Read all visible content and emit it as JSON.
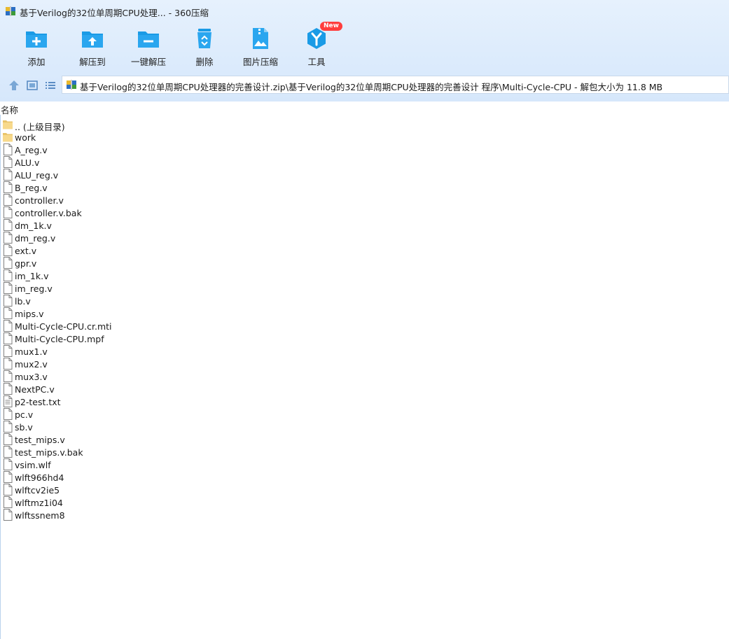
{
  "window": {
    "title": "基于Verilog的32位单周期CPU处理... - 360压缩"
  },
  "colors": {
    "accent": "#1a9be6",
    "band": "#dcebfc",
    "badge": "#ff3d3d"
  },
  "toolbar": {
    "items": [
      {
        "label": "添加",
        "icon": "add-folder-icon"
      },
      {
        "label": "解压到",
        "icon": "extract-to-icon"
      },
      {
        "label": "一键解压",
        "icon": "one-click-extract-icon"
      },
      {
        "label": "删除",
        "icon": "recycle-bin-icon"
      },
      {
        "label": "图片压缩",
        "icon": "image-compress-icon"
      },
      {
        "label": "工具",
        "icon": "tools-icon",
        "badge": "New"
      }
    ]
  },
  "nav": {
    "address": "基于Verilog的32位单周期CPU处理器的完善设计.zip\\基于Verilog的32位单周期CPU处理器的完善设计 程序\\Multi-Cycle-CPU - 解包大小为 11.8 MB"
  },
  "list": {
    "column_name": "名称",
    "items": [
      {
        "name": ".. (上级目录)",
        "type": "folder"
      },
      {
        "name": "work",
        "type": "folder"
      },
      {
        "name": "A_reg.v",
        "type": "file"
      },
      {
        "name": "ALU.v",
        "type": "file"
      },
      {
        "name": "ALU_reg.v",
        "type": "file"
      },
      {
        "name": "B_reg.v",
        "type": "file"
      },
      {
        "name": "controller.v",
        "type": "file"
      },
      {
        "name": "controller.v.bak",
        "type": "file"
      },
      {
        "name": "dm_1k.v",
        "type": "file"
      },
      {
        "name": "dm_reg.v",
        "type": "file"
      },
      {
        "name": "ext.v",
        "type": "file"
      },
      {
        "name": "gpr.v",
        "type": "file"
      },
      {
        "name": "im_1k.v",
        "type": "file"
      },
      {
        "name": "im_reg.v",
        "type": "file"
      },
      {
        "name": "lb.v",
        "type": "file"
      },
      {
        "name": "mips.v",
        "type": "file"
      },
      {
        "name": "Multi-Cycle-CPU.cr.mti",
        "type": "file"
      },
      {
        "name": "Multi-Cycle-CPU.mpf",
        "type": "file"
      },
      {
        "name": "mux1.v",
        "type": "file"
      },
      {
        "name": "mux2.v",
        "type": "file"
      },
      {
        "name": "mux3.v",
        "type": "file"
      },
      {
        "name": "NextPC.v",
        "type": "file"
      },
      {
        "name": "p2-test.txt",
        "type": "text"
      },
      {
        "name": "pc.v",
        "type": "file"
      },
      {
        "name": "sb.v",
        "type": "file"
      },
      {
        "name": "test_mips.v",
        "type": "file"
      },
      {
        "name": "test_mips.v.bak",
        "type": "file"
      },
      {
        "name": "vsim.wlf",
        "type": "file"
      },
      {
        "name": "wlft966hd4",
        "type": "file"
      },
      {
        "name": "wlftcv2ie5",
        "type": "file"
      },
      {
        "name": "wlftmz1i04",
        "type": "file"
      },
      {
        "name": "wlftssnem8",
        "type": "file"
      }
    ]
  }
}
